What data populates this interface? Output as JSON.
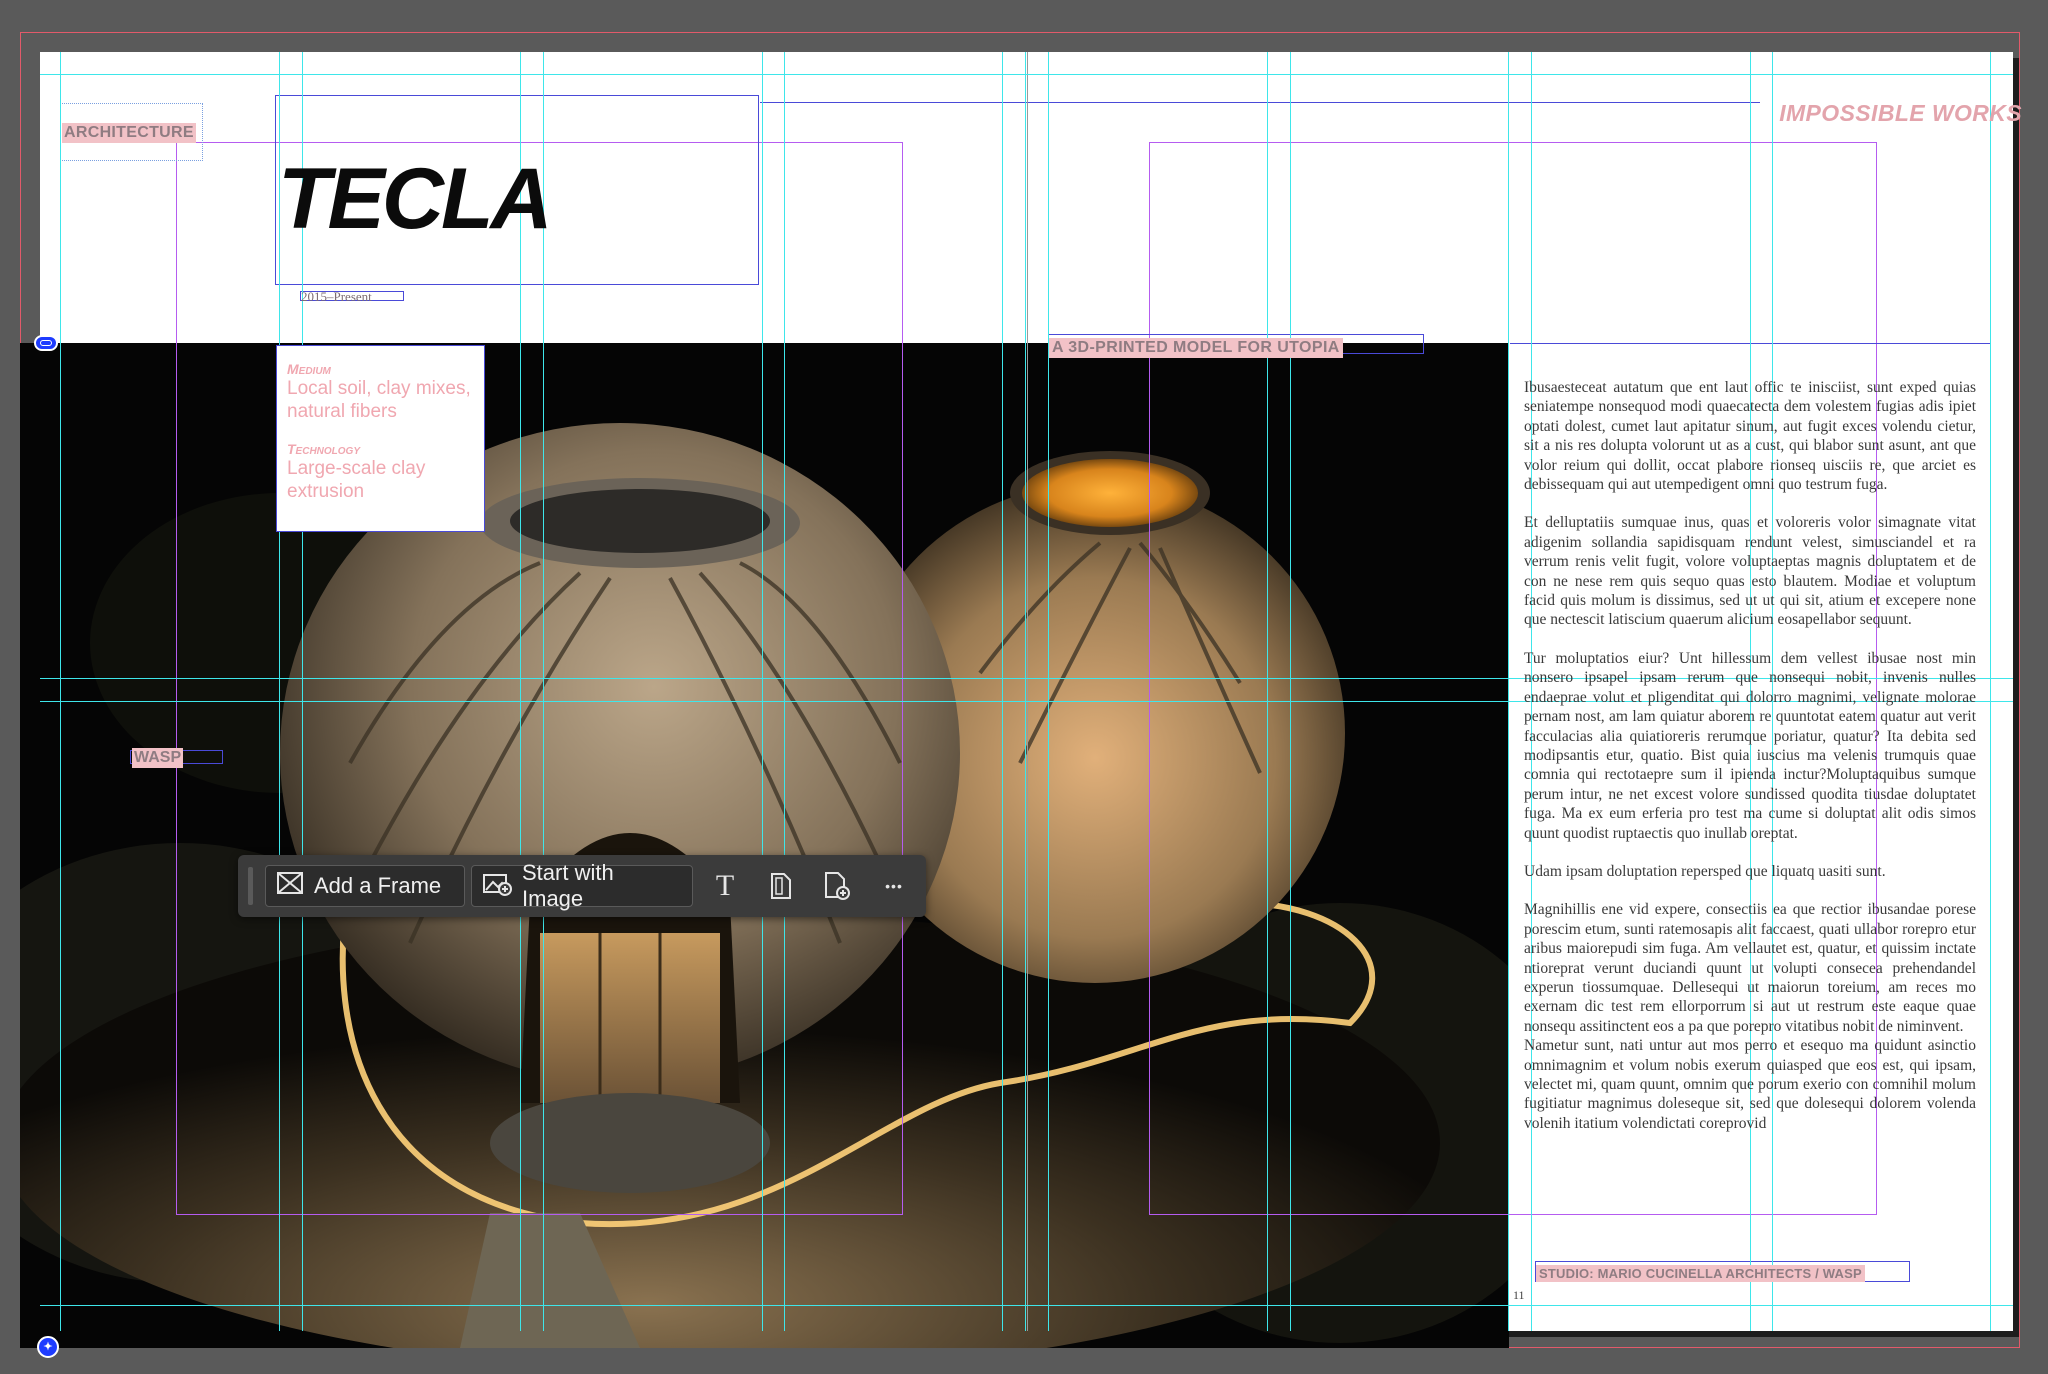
{
  "spread": {
    "section_label": "ARCHITECTURE",
    "title": "TECLA",
    "dates": "2015–Present",
    "kicker": "IMPOSSIBLE WORKS",
    "subhead": "A 3D-PRINTED MODEL FOR UTOPIA",
    "photo_tag": "WASP",
    "info": {
      "medium_label": "Medium",
      "medium_value": "Local soil, clay mixes, natural fibers",
      "technology_label": "Technology",
      "technology_value": "Large-scale clay extrusion"
    },
    "body": [
      "Ibusaesteceat autatum que ent laut offic te inisciist, sunt exped quias seniatempe nonsequod modi quaecatecta dem volestem fugias adis ipiet optati dolest, cumet laut apitatur sinum, aut fugit exces volendu cietur, sit a nis res dolupta volorunt ut as a cust, qui blabor sunt asunt, ant que volor reium qui dollit, occat plabore rionseq uisciis re, que arciet es debissequam qui aut utempedigent omni quo testrum fuga.",
      "Et delluptatiis sumquae inus, quas et voloreris volor simagnate vitat adigenim sollandia sapidisquam rendunt velest, simusciandel et ra verrum renis velit fugit, volore voluptaeptas magnis doluptatem et de con ne nese rem quis sequo quas esto blautem. Modiae et voluptum facid quis molum is dissimus, sed ut ut qui sit, atium et excepere none que nectescit latiscium quaerum alicium eosapellabor sequunt.",
      "Tur moluptatios eiur? Unt hillessum dem vellest ibusae nost min nonsero ipsapel ipsam rerum que nonsequi nobit, invenis nulles endaeprae volut et pligenditat qui dolorro magnimi, velignate molorae pernam nost, am lam quiatur aborem re quuntotat eatem quatur aut verit facculacias alia quiatioreris rerumque poriatur, quatur? Ita debita sed modipsantis etur, quatio. Bist quia iuscius ma velenis trumquis quae comnia qui rectotaepre sum il ipienda inctur?Moluptaquibus sumque perum intur, ne net excest volore sundissed quodita tiusdae doluptatet fuga. Ma ex eum erferia pro test ma cume si doluptat alit odis simos quunt quodist ruptaectis quo inullab oreptat.",
      "Udam ipsam doluptation repersped que liquatq uasiti sunt.",
      "Magnihillis ene vid expere, consectiis ea que rectior ibusandae porese porescim etum, sunti ratemosapis alit faccaest, quati ullabor rorepro etur aribus maiorepudi sim fuga. Am vellautet est, quatur, et quissim inctate ntioreprat verunt duciandi quunt ut volupti consecea prehendandel experun tiossumquae. Dellesequi ut maiorun toreium, am reces mo exernam dic test rem ellorporrum si aut ut restrum este eaque quae nonsequ assitinctent eos a pa que porepro vitatibus nobit de niminvent.",
      "Nametur sunt, nati untur aut mos perro et esequo ma quidunt asinctio omnimagnim et volum nobis exerum quiasped que eos est, qui ipsam, velectet mi, quam quunt, omnim que porum exerio con comnihil molum fugitiatur magnimus doleseque sit, sed que dolesequi dolorem volenda volenih itatium volendictati coreprovid"
    ],
    "credit": "STUDIO: MARIO CUCINELLA ARCHITECTS / WASP",
    "folio": "11"
  },
  "toolbar": {
    "add_frame": "Add a Frame",
    "start_with_image": "Start with Image",
    "text_icon": "T",
    "more_icon": "•••"
  },
  "colors": {
    "guide_cyan": "#3ee6ea",
    "margin_purple": "#b55cf0",
    "frame_blue": "#4a4ad8",
    "bleed_red": "#e25a6a",
    "highlight_pink": "#f2c2c7",
    "kicker_pink": "#e3a4ac",
    "pasteboard": "#5a5a5a"
  },
  "icons": [
    "frame-icon",
    "image-add-icon",
    "text-tool-icon",
    "page-icon",
    "add-page-icon",
    "more-icon",
    "link-icon",
    "content-badge-icon"
  ]
}
